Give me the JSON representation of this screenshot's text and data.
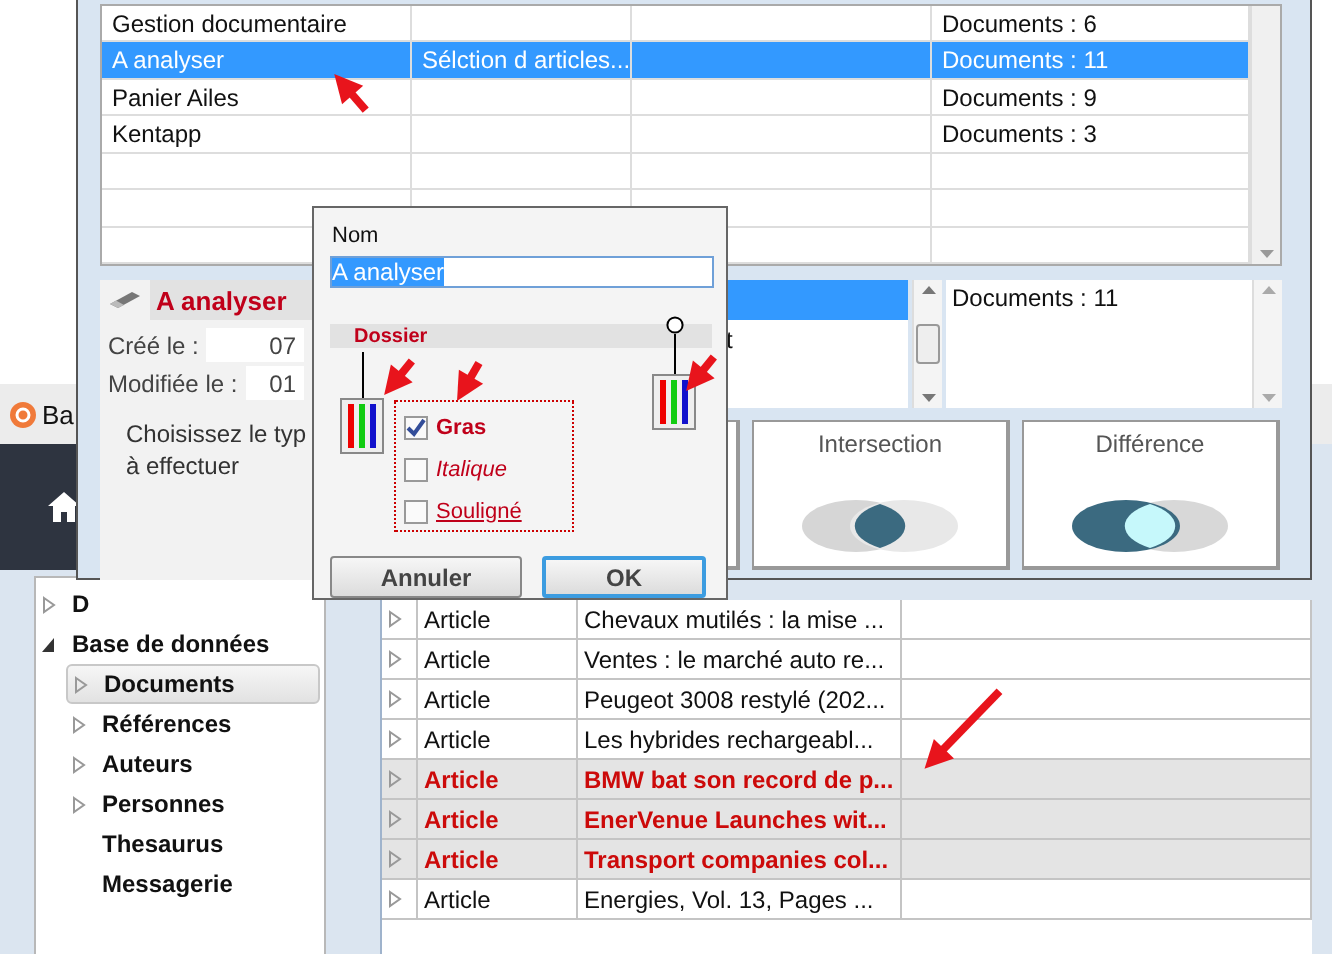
{
  "back_window": {
    "title": "Ba",
    "tree": [
      {
        "label": "D",
        "expandable": true,
        "expanded": false,
        "selected": false
      },
      {
        "label": "Base de données",
        "expandable": true,
        "expanded": true,
        "selected": false,
        "children": [
          {
            "label": "Documents",
            "expandable": true,
            "expanded": false,
            "selected": true
          },
          {
            "label": "Références",
            "expandable": true,
            "expanded": false,
            "selected": false
          },
          {
            "label": "Auteurs",
            "expandable": true,
            "expanded": false,
            "selected": false
          },
          {
            "label": "Personnes",
            "expandable": true,
            "expanded": false,
            "selected": false
          },
          {
            "label": "Thesaurus",
            "expandable": false,
            "selected": false
          },
          {
            "label": "Messagerie",
            "expandable": false,
            "selected": false
          }
        ]
      }
    ],
    "documents": [
      {
        "type": "Article",
        "title": "Chevaux mutilés : la mise ...",
        "highlighted": false
      },
      {
        "type": "Article",
        "title": "Ventes : le marché auto re...",
        "highlighted": false
      },
      {
        "type": "Article",
        "title": "Peugeot 3008 restylé (202...",
        "highlighted": false
      },
      {
        "type": "Article",
        "title": "Les hybrides rechargeabl...",
        "highlighted": false
      },
      {
        "type": "Article",
        "title": "BMW bat son record de p...",
        "highlighted": true
      },
      {
        "type": "Article",
        "title": "EnerVenue Launches wit...",
        "highlighted": true
      },
      {
        "type": "Article",
        "title": "Transport companies col...",
        "highlighted": true
      },
      {
        "type": "Article",
        "title": "Energies, Vol. 13, Pages ...",
        "highlighted": false
      }
    ]
  },
  "front_window": {
    "folders": [
      {
        "name": "Gestion documentaire",
        "count": "Documents : 6",
        "selected": false
      },
      {
        "name": "A analyser",
        "description": "Sélction d articles...",
        "count": "Documents : 11",
        "selected": true
      },
      {
        "name": "Panier Ailes",
        "count": "Documents : 9",
        "selected": false
      },
      {
        "name": "Kentapp",
        "count": "Documents : 3",
        "selected": false
      }
    ],
    "detail": {
      "title": "A analyser",
      "created_label": "Créé le :",
      "created_value": "07",
      "modified_label": "Modifiée le :",
      "modified_value": "01",
      "prompt_lines": [
        "Choisissez le typ",
        "à effectuer"
      ]
    },
    "side_list": [
      {
        "selected": true
      },
      {
        "text": "t",
        "selected": false
      }
    ],
    "count_box": "Documents : 11",
    "operations": [
      {
        "label": "Intersection",
        "kind": "intersection"
      },
      {
        "label": "Différence",
        "kind": "difference"
      }
    ]
  },
  "dialog": {
    "name_label": "Nom",
    "name_value": "A analyser",
    "group_label": "Dossier",
    "styles": [
      {
        "label": "Gras",
        "kind": "bold",
        "checked": true
      },
      {
        "label": "Italique",
        "kind": "italic",
        "checked": false
      },
      {
        "label": "Souligné",
        "kind": "underline",
        "checked": false
      }
    ],
    "buttons": [
      {
        "label": "Annuler",
        "default": false
      },
      {
        "label": "OK",
        "default": true
      }
    ]
  }
}
